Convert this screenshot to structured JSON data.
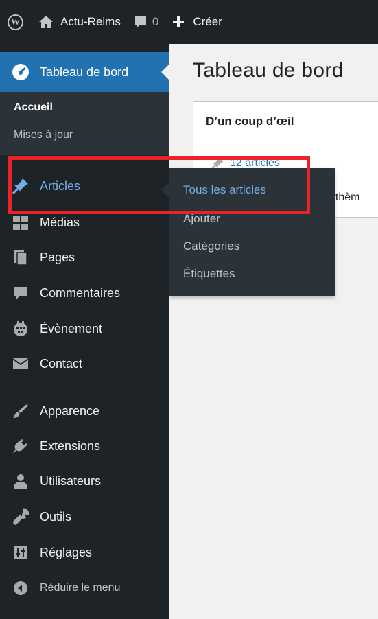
{
  "adminbar": {
    "site_name": "Actu-Reims",
    "comments_count": "0",
    "create_label": "Créer"
  },
  "sidebar": {
    "dashboard_label": "Tableau de bord",
    "submenu": [
      "Accueil",
      "Mises à jour"
    ],
    "items": [
      {
        "label": "Articles",
        "icon": "pushpin-icon"
      },
      {
        "label": "Médias",
        "icon": "media-icon"
      },
      {
        "label": "Pages",
        "icon": "pages-icon"
      },
      {
        "label": "Commentaires",
        "icon": "comment-icon"
      },
      {
        "label": "Évènement",
        "icon": "calendar-icon"
      },
      {
        "label": "Contact",
        "icon": "envelope-icon"
      },
      {
        "label": "Apparence",
        "icon": "paintbrush-icon"
      },
      {
        "label": "Extensions",
        "icon": "plugin-icon"
      },
      {
        "label": "Utilisateurs",
        "icon": "users-icon"
      },
      {
        "label": "Outils",
        "icon": "wrench-icon"
      },
      {
        "label": "Réglages",
        "icon": "settings-icon"
      }
    ],
    "collapse_label": "Réduire le menu"
  },
  "flyout": {
    "items": [
      "Tous les articles",
      "Ajouter",
      "Catégories",
      "Étiquettes"
    ]
  },
  "main": {
    "title": "Tableau de bord",
    "glance": {
      "title": "D’un coup d’œil",
      "articles": "12 articles",
      "theme_fragment": "le thèm"
    }
  },
  "colors": {
    "adminbar": "#1d2327",
    "accent": "#2271b1",
    "link_active": "#72aee6",
    "annotation": "#e8242a"
  }
}
